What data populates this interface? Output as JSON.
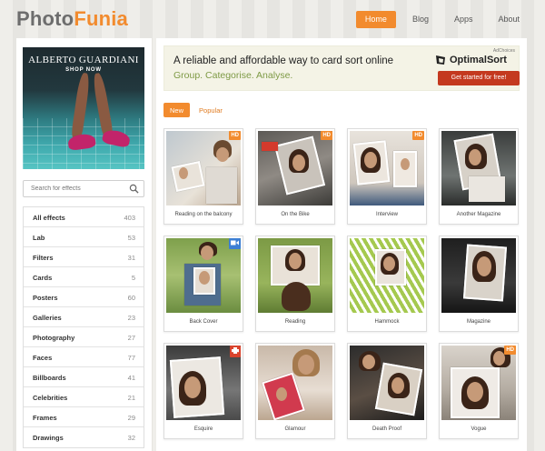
{
  "header": {
    "logo_part1": "Photo",
    "logo_part2": "Funia",
    "nav": [
      {
        "label": "Home",
        "active": true
      },
      {
        "label": "Blog",
        "active": false
      },
      {
        "label": "Apps",
        "active": false
      },
      {
        "label": "About",
        "active": false
      }
    ]
  },
  "sidebar": {
    "ad": {
      "brand": "ALBERTO GUARDIANI",
      "cta": "SHOP NOW"
    },
    "search_placeholder": "Search for effects",
    "categories": [
      {
        "label": "All effects",
        "count": "403"
      },
      {
        "label": "Lab",
        "count": "53"
      },
      {
        "label": "Filters",
        "count": "31"
      },
      {
        "label": "Cards",
        "count": "5"
      },
      {
        "label": "Posters",
        "count": "60"
      },
      {
        "label": "Galleries",
        "count": "23"
      },
      {
        "label": "Photography",
        "count": "27"
      },
      {
        "label": "Faces",
        "count": "77"
      },
      {
        "label": "Billboards",
        "count": "41"
      },
      {
        "label": "Celebrities",
        "count": "21"
      },
      {
        "label": "Frames",
        "count": "29"
      },
      {
        "label": "Drawings",
        "count": "32"
      }
    ]
  },
  "banner": {
    "headline": "A reliable and affordable way to card sort online",
    "subline": "Group. Categorise. Analyse.",
    "adchoices": "AdChoices",
    "brand": "OptimalSort",
    "cta": "Get started for free!"
  },
  "tabs": [
    {
      "label": "New",
      "active": true
    },
    {
      "label": "Popular",
      "active": false
    }
  ],
  "effects": [
    {
      "label": "Reading on the balcony",
      "badge": "HD"
    },
    {
      "label": "On the Bike",
      "badge": "HD"
    },
    {
      "label": "Interview",
      "badge": "HD"
    },
    {
      "label": "Another Magazine",
      "badge": ""
    },
    {
      "label": "Back Cover",
      "badge": "video"
    },
    {
      "label": "Reading",
      "badge": ""
    },
    {
      "label": "Hammock",
      "badge": ""
    },
    {
      "label": "Magazine",
      "badge": ""
    },
    {
      "label": "Esquire",
      "badge": "print"
    },
    {
      "label": "Glamour",
      "badge": ""
    },
    {
      "label": "Death Proof",
      "badge": ""
    },
    {
      "label": "Vogue",
      "badge": "HD"
    }
  ],
  "colors": {
    "accent": "#f28b2e",
    "video_badge": "#3d7fd4",
    "print_badge": "#d9432c"
  }
}
